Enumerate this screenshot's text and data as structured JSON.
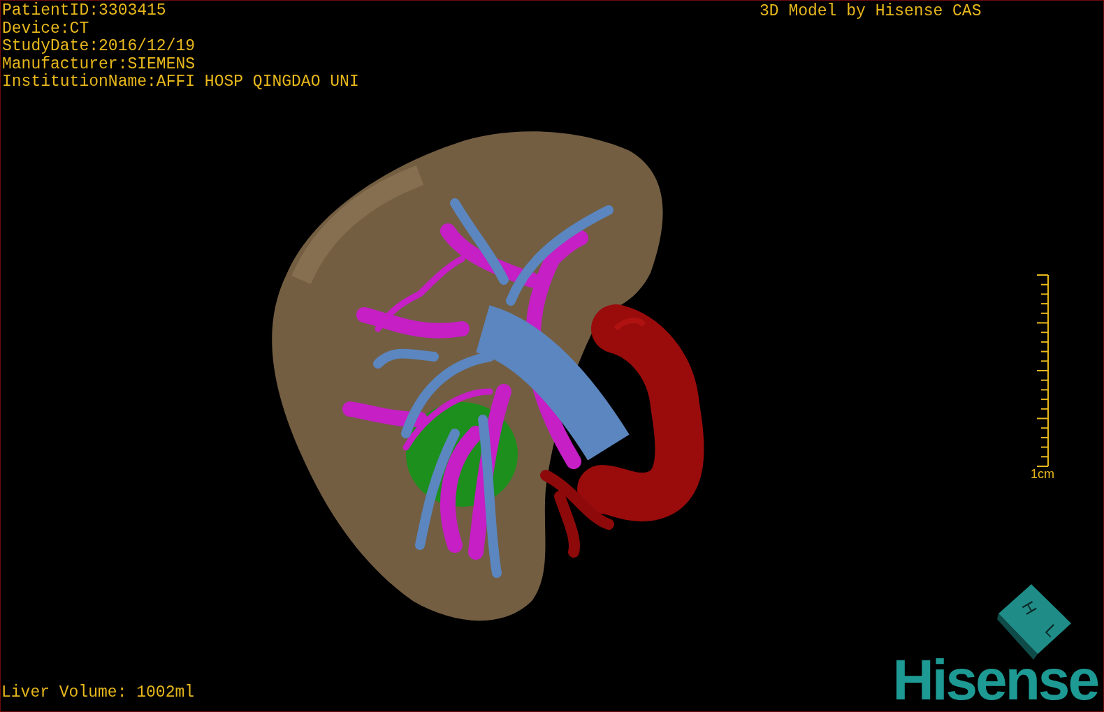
{
  "viewer": {
    "info_lines": [
      "PatientID:3303415",
      "Device:CT",
      "StudyDate:2016/12/19",
      "Manufacturer:SIEMENS",
      "InstitutionName:AFFI HOSP QINGDAO UNI"
    ],
    "title": "3D Model by Hisense CAS",
    "scale": {
      "label": "1cm"
    },
    "orientation_cube": {
      "labels": [
        "H",
        "L"
      ]
    },
    "liver_volume": "Liver Volume: 1002ml",
    "brand": "Hisense"
  }
}
